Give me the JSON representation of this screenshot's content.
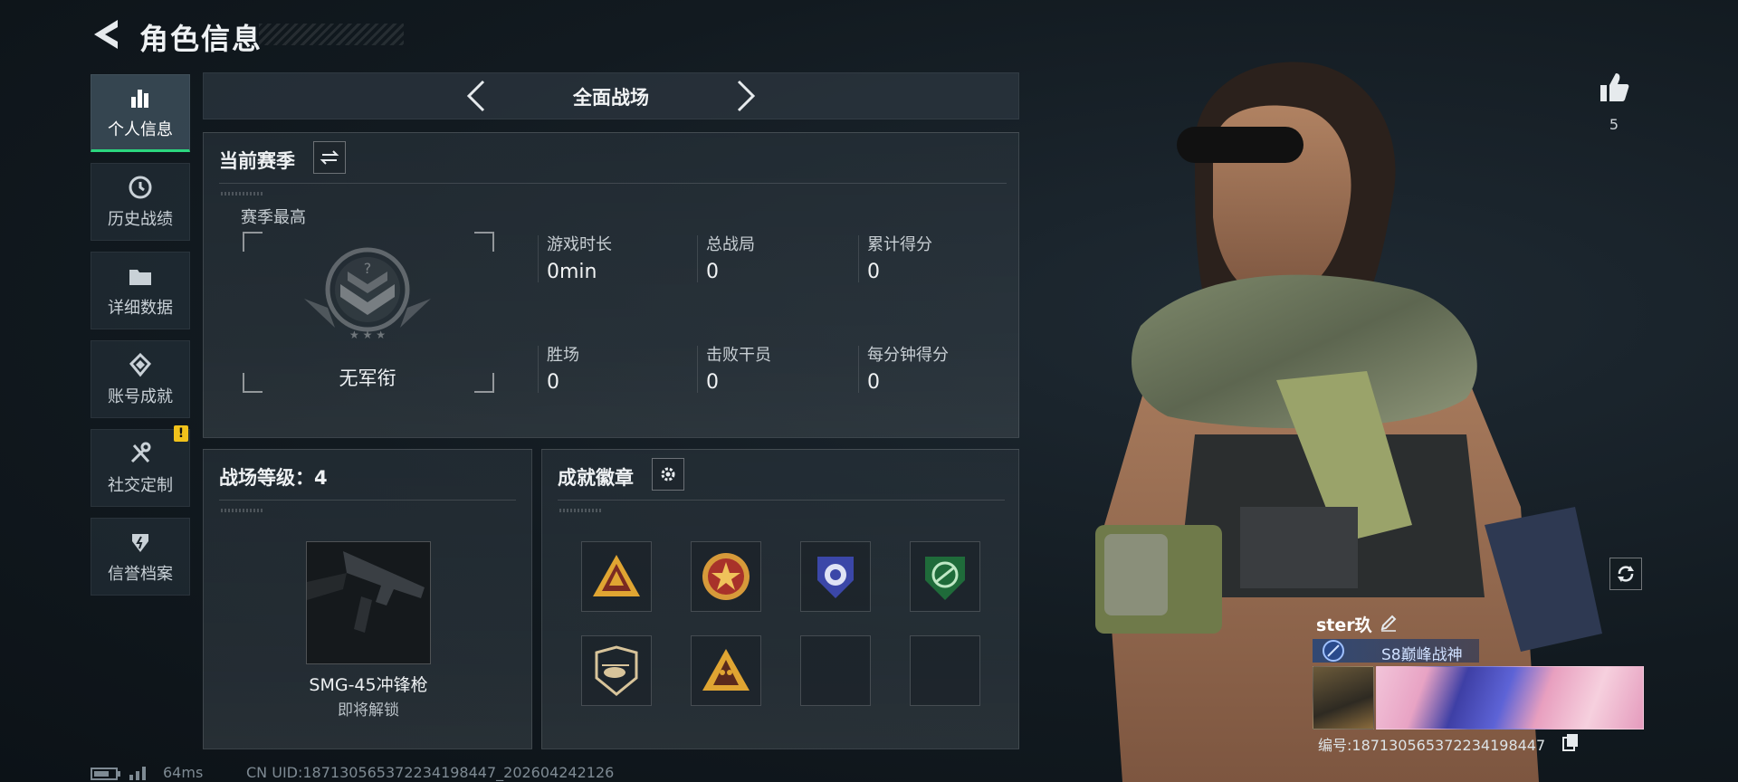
{
  "header": {
    "title": "角色信息"
  },
  "sidebar": {
    "items": [
      {
        "label": "个人信息",
        "icon": "bar-chart-icon",
        "active": true
      },
      {
        "label": "历史战绩",
        "icon": "history-clock-icon"
      },
      {
        "label": "详细数据",
        "icon": "folder-icon"
      },
      {
        "label": "账号成就",
        "icon": "achievement-icon"
      },
      {
        "label": "社交定制",
        "icon": "wrench-screwdriver-icon",
        "badge": "!"
      },
      {
        "label": "信誉档案",
        "icon": "credit-shield-icon"
      }
    ]
  },
  "mode": {
    "label": "全面战场"
  },
  "season": {
    "title": "当前赛季",
    "best_label": "赛季最高",
    "rank_name": "无军衔",
    "stats": [
      {
        "label": "游戏时长",
        "value": "0min"
      },
      {
        "label": "总战局",
        "value": "0"
      },
      {
        "label": "累计得分",
        "value": "0"
      },
      {
        "label": "胜场",
        "value": "0"
      },
      {
        "label": "击败干员",
        "value": "0"
      },
      {
        "label": "每分钟得分",
        "value": "0"
      }
    ]
  },
  "battlefield": {
    "title": "战场等级：4",
    "weapon_name": "SMG-45冲锋枪",
    "weapon_status": "即将解锁"
  },
  "achievements": {
    "title": "成就徽章",
    "badges": [
      "pyramid-badge",
      "star-medal-badge",
      "blue-shield-badge",
      "green-shield-badge",
      "helicopter-badge",
      "soldiers-badge",
      "",
      ""
    ]
  },
  "status": {
    "ping": "64ms",
    "uid": "CN UID:18713056537223419844​7_202604242126"
  },
  "player": {
    "likes": "5",
    "name": "ster玖",
    "rank_title": "S8巅峰战神",
    "id_label": "编号:18713056537223419844​7"
  },
  "colors": {
    "accent_green": "#2bd77e",
    "warning_yellow": "#f1c21b"
  }
}
